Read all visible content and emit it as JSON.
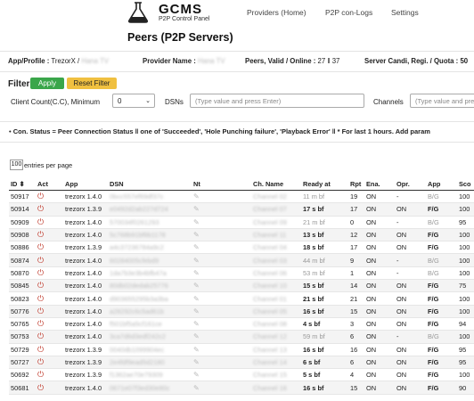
{
  "nav": {
    "brand": "GCMS",
    "subtitle": "P2P Control Panel",
    "links": [
      "Providers (Home)",
      "P2P con-Logs",
      "Settings"
    ]
  },
  "page_title": "Peers (P2P Servers)",
  "info": {
    "app_profile_label": "App/Profile :",
    "app_profile_value": "TrezorX /",
    "app_profile_blur": "Hana TV",
    "provider_label": "Provider Name :",
    "provider_value": "Hana TV",
    "peers_label": "Peers, Valid / Online :",
    "peers_value": "27 ‖ 37",
    "server_label": "Server Candi, Regi. / Quota : 50"
  },
  "filter": {
    "title": "Filter",
    "apply": "Apply",
    "reset": "Reset Filter",
    "cc_label": "Client Count(C.C), Minimum",
    "cc_value": "0",
    "dsn_label": "DSNs",
    "dsn_placeholder": "(Type value and press Enter)",
    "channels_label": "Channels",
    "channels_placeholder": "(Type value and press Enter). Add param"
  },
  "note": "Con. Status = Peer Connection Status ‖ one of 'Succeeded', 'Hole Punching failure', 'Playback Error' ‖ * For last 1 hours. Add param",
  "pager": {
    "per_page": "100",
    "label": "entries per page"
  },
  "table": {
    "headers": [
      "ID ⬍",
      "Act",
      "App",
      "DSN",
      "Nt",
      "Ch. Name",
      "Ready at",
      "Rpt",
      "Ena.",
      "Opr.",
      "App",
      "Sco"
    ],
    "rows": [
      {
        "id": "50917",
        "app": "trezorx 1.4.0",
        "dsn": "0bcc557ef69df37c",
        "ch": "Channel 02",
        "ready": "11 m bf",
        "rpt": "19",
        "ena": "ON",
        "opr": "-",
        "app2": "B/G",
        "sco": "100",
        "muted": true
      },
      {
        "id": "50914",
        "app": "trezorx 1.3.9",
        "dsn": "e0492d2ab227d724",
        "ch": "Channel 07",
        "ready": "17 s bf",
        "rpt": "17",
        "ena": "ON",
        "opr": "ON",
        "app2": "F/G",
        "sco": "100",
        "muted": false
      },
      {
        "id": "50909",
        "app": "trezorx 1.4.0",
        "dsn": "570034f0261293",
        "ch": "Channel 09",
        "ready": "21 m bf",
        "rpt": "0",
        "ena": "ON",
        "opr": "-",
        "app2": "B/G",
        "sco": "95",
        "muted": true
      },
      {
        "id": "50908",
        "app": "trezorx 1.4.0",
        "dsn": "5c768b91bf6b1178",
        "ch": "Channel 11",
        "ready": "13 s bf",
        "rpt": "12",
        "ena": "ON",
        "opr": "ON",
        "app2": "F/G",
        "sco": "100",
        "muted": false
      },
      {
        "id": "50886",
        "app": "trezorx 1.3.9",
        "dsn": "a4c37236784a9c2",
        "ch": "Channel 04",
        "ready": "18 s bf",
        "rpt": "17",
        "ena": "ON",
        "opr": "ON",
        "app2": "F/G",
        "sco": "100",
        "muted": false
      },
      {
        "id": "50874",
        "app": "trezorx 1.4.0",
        "dsn": "60284005cfebd9",
        "ch": "Channel 03",
        "ready": "44 m bf",
        "rpt": "9",
        "ena": "ON",
        "opr": "-",
        "app2": "B/G",
        "sco": "100",
        "muted": true
      },
      {
        "id": "50870",
        "app": "trezorx 1.4.0",
        "dsn": "1da7b3e3b4bfb47a",
        "ch": "Channel 06",
        "ready": "53 m bf",
        "rpt": "1",
        "ena": "ON",
        "opr": "-",
        "app2": "B/G",
        "sco": "100",
        "muted": true
      },
      {
        "id": "50845",
        "app": "trezorx 1.4.0",
        "dsn": "80db02dedab25776",
        "ch": "Channel 10",
        "ready": "15 s bf",
        "rpt": "14",
        "ena": "ON",
        "opr": "ON",
        "app2": "F/G",
        "sco": "75",
        "muted": false
      },
      {
        "id": "50823",
        "app": "trezorx 1.4.0",
        "dsn": "d903655295b3a3ba",
        "ch": "Channel 01",
        "ready": "21 s bf",
        "rpt": "21",
        "ena": "ON",
        "opr": "ON",
        "app2": "F/G",
        "sco": "100",
        "muted": false
      },
      {
        "id": "50776",
        "app": "trezorx 1.4.0",
        "dsn": "a28292c6c5ad61b",
        "ch": "Channel 05",
        "ready": "16 s bf",
        "rpt": "15",
        "ena": "ON",
        "opr": "ON",
        "app2": "F/G",
        "sco": "100",
        "muted": false
      },
      {
        "id": "50765",
        "app": "trezorx 1.4.0",
        "dsn": "f501bf5a5cf161ce",
        "ch": "Channel 08",
        "ready": "4 s bf",
        "rpt": "3",
        "ena": "ON",
        "opr": "ON",
        "app2": "F/G",
        "sco": "94",
        "muted": false
      },
      {
        "id": "50753",
        "app": "trezorx 1.4.0",
        "dsn": "3ca7d6d3edf242c2",
        "ch": "Channel 12",
        "ready": "59 m bf",
        "rpt": "6",
        "ena": "ON",
        "opr": "-",
        "app2": "B/G",
        "sco": "100",
        "muted": true
      },
      {
        "id": "50729",
        "app": "trezorx 1.3.9",
        "dsn": "0040db1099904ec",
        "ch": "Channel 13",
        "ready": "16 s bf",
        "rpt": "16",
        "ena": "ON",
        "opr": "ON",
        "app2": "F/G",
        "sco": "95",
        "muted": false
      },
      {
        "id": "50727",
        "app": "trezorx 1.3.9",
        "dsn": "2e4fdf9ead5d2180",
        "ch": "Channel 14",
        "ready": "6 s bf",
        "rpt": "6",
        "ena": "ON",
        "opr": "ON",
        "app2": "F/G",
        "sco": "95",
        "muted": false
      },
      {
        "id": "50692",
        "app": "trezorx 1.3.9",
        "dsn": "f1362ae70e79309",
        "ch": "Channel 15",
        "ready": "5 s bf",
        "rpt": "4",
        "ena": "ON",
        "opr": "ON",
        "app2": "F/G",
        "sco": "100",
        "muted": false
      },
      {
        "id": "50681",
        "app": "trezorx 1.4.0",
        "dsn": "0671e07f3ed30e80c",
        "ch": "Channel 16",
        "ready": "16 s bf",
        "rpt": "15",
        "ena": "ON",
        "opr": "ON",
        "app2": "F/G",
        "sco": "90",
        "muted": false
      }
    ]
  }
}
